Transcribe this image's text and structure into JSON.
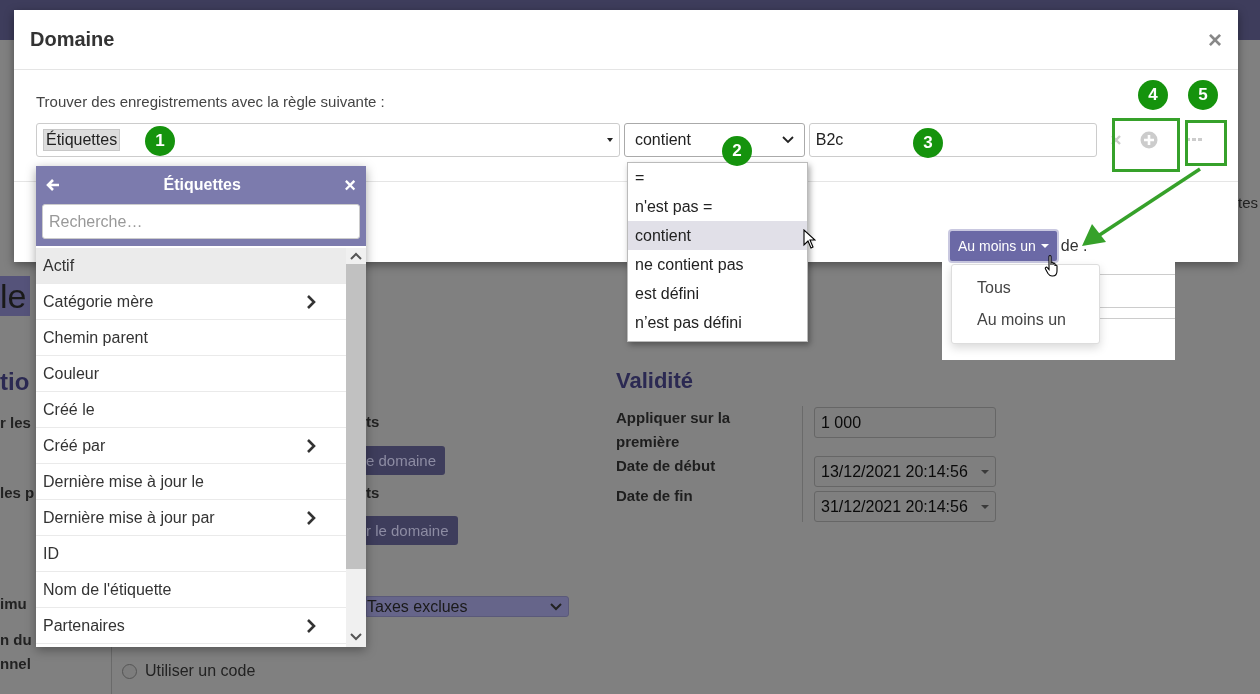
{
  "background": {
    "fragments": [
      {
        "kind": "title",
        "text": "le"
      },
      {
        "kind": "heading",
        "text": "tio"
      },
      {
        "kind": "label",
        "text": "r les"
      },
      {
        "kind": "label",
        "text": "les p"
      },
      {
        "kind": "label",
        "text": "imu"
      },
      {
        "kind": "label",
        "text": "n du"
      },
      {
        "kind": "label",
        "text": "nnel"
      },
      {
        "kind": "label",
        "text": "ts"
      },
      {
        "kind": "button",
        "text": "e domaine"
      },
      {
        "kind": "label",
        "text": "ts"
      },
      {
        "kind": "button",
        "text": "r le domaine"
      },
      {
        "kind": "select",
        "text": "Taxes exclues"
      },
      {
        "kind": "radio",
        "text": "Utiliser un code",
        "checked": false
      },
      {
        "kind": "text",
        "text": "tes"
      }
    ],
    "validity": {
      "title": "Validité",
      "fields": [
        {
          "label": "Appliquer sur la première",
          "value": "1 000",
          "kind": "input"
        },
        {
          "label": "Date de début",
          "value": "13/12/2021 20:14:56",
          "kind": "date"
        },
        {
          "label": "Date de fin",
          "value": "31/12/2021 20:14:56",
          "kind": "date"
        }
      ]
    }
  },
  "modal": {
    "title": "Domaine",
    "close": "×",
    "rule_label": "Trouver des enregistrements avec la règle suivante :",
    "field": "Étiquettes",
    "operator": "contient",
    "value": "B2c"
  },
  "field_popover": {
    "title": "Étiquettes",
    "close": "×",
    "search_placeholder": "Recherche…",
    "items": [
      {
        "label": "Actif",
        "has_children": false,
        "selected": true
      },
      {
        "label": "Catégorie mère",
        "has_children": true,
        "selected": false
      },
      {
        "label": "Chemin parent",
        "has_children": false,
        "selected": false
      },
      {
        "label": "Couleur",
        "has_children": false,
        "selected": false
      },
      {
        "label": "Créé le",
        "has_children": false,
        "selected": false
      },
      {
        "label": "Créé par",
        "has_children": true,
        "selected": false
      },
      {
        "label": "Dernière mise à jour le",
        "has_children": false,
        "selected": false
      },
      {
        "label": "Dernière mise à jour par",
        "has_children": true,
        "selected": false
      },
      {
        "label": "ID",
        "has_children": false,
        "selected": false
      },
      {
        "label": "Nom de l'étiquette",
        "has_children": false,
        "selected": false
      },
      {
        "label": "Partenaires",
        "has_children": true,
        "selected": false
      }
    ]
  },
  "operator_menu": [
    {
      "label": "=",
      "selected": false
    },
    {
      "label": "n'est pas =",
      "selected": false
    },
    {
      "label": "contient",
      "selected": true
    },
    {
      "label": "ne contient pas",
      "selected": false
    },
    {
      "label": "est défini",
      "selected": false
    },
    {
      "label": "n’est pas défini",
      "selected": false
    }
  ],
  "inset": {
    "quantifier_button": "Au moins un",
    "label": "de :",
    "menu": [
      "Tous",
      "Au moins un"
    ]
  },
  "annotations": {
    "badges": [
      "1",
      "2",
      "3",
      "4",
      "5"
    ]
  }
}
